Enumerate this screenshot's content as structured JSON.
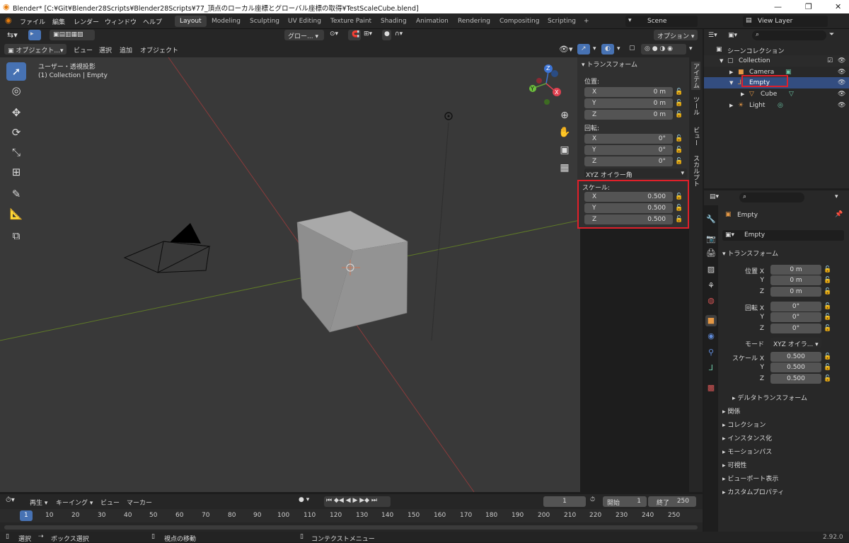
{
  "window": {
    "title": "Blender* [C:¥Git¥Blender28Scripts¥Blender28Scripts¥77_頂点のローカル座標とグローバル座標の取得¥TestScaleCube.blend]",
    "controls": [
      "—",
      "❐",
      "✕"
    ]
  },
  "menu": {
    "items": [
      "ファイル",
      "編集",
      "レンダー",
      "ウィンドウ",
      "ヘルプ"
    ],
    "workspaces": [
      "Layout",
      "Modeling",
      "Sculpting",
      "UV Editing",
      "Texture Paint",
      "Shading",
      "Animation",
      "Rendering",
      "Compositing",
      "Scripting"
    ],
    "add_tab": "+",
    "scene": "Scene",
    "view_layer": "View Layer"
  },
  "viewport_header": {
    "transform": "グロー...",
    "options": "オプション",
    "mode": "オブジェクト...",
    "menus": [
      "ビュー",
      "選択",
      "追加",
      "オブジェクト"
    ]
  },
  "viewport": {
    "info_line1": "ユーザー・透視投影",
    "info_line2": "(1) Collection | Empty",
    "gizmo": {
      "x": "X",
      "y": "Y",
      "z": "Z"
    }
  },
  "npanel": {
    "header": "トランスフォーム",
    "location_label": "位置:",
    "rotation_label": "回転:",
    "scale_label": "スケール:",
    "location": [
      {
        "axis": "X",
        "value": "0 m"
      },
      {
        "axis": "Y",
        "value": "0 m"
      },
      {
        "axis": "Z",
        "value": "0 m"
      }
    ],
    "rotation": [
      {
        "axis": "X",
        "value": "0°"
      },
      {
        "axis": "Y",
        "value": "0°"
      },
      {
        "axis": "Z",
        "value": "0°"
      }
    ],
    "rotation_mode": "XYZ オイラー角",
    "scale": [
      {
        "axis": "X",
        "value": "0.500"
      },
      {
        "axis": "Y",
        "value": "0.500"
      },
      {
        "axis": "Z",
        "value": "0.500"
      }
    ],
    "tabs": [
      "アイテム",
      "ツール",
      "ビュー",
      "スカルプト"
    ]
  },
  "outliner": {
    "root": "シーンコレクション",
    "collection": "Collection",
    "camera": "Camera",
    "empty": "Empty",
    "cube": "Cube",
    "light": "Light"
  },
  "properties": {
    "object_name": "Empty",
    "data_name": "Empty",
    "transform_header": "トランスフォーム",
    "location_x_label": "位置 X",
    "y_label": "Y",
    "z_label": "Z",
    "location": [
      "0 m",
      "0 m",
      "0 m"
    ],
    "rotation_x_label": "回転 X",
    "rotation": [
      "0°",
      "0°",
      "0°"
    ],
    "mode_label": "モード",
    "mode_value": "XYZ オイラ...",
    "scale_x_label": "スケール X",
    "scale": [
      "0.500",
      "0.500",
      "0.500"
    ],
    "delta": "デルタトランスフォーム",
    "sections": [
      "関係",
      "コレクション",
      "インスタンス化",
      "モーションパス",
      "可視性",
      "ビューポート表示",
      "カスタムプロパティ"
    ]
  },
  "timeline": {
    "menus": [
      "再生",
      "キーイング",
      "ビュー",
      "マーカー"
    ],
    "current_frame": "1",
    "start_label": "開始",
    "start": "1",
    "end_label": "終了",
    "end": "250",
    "ruler": [
      "1",
      "10",
      "20",
      "30",
      "40",
      "50",
      "60",
      "70",
      "80",
      "90",
      "100",
      "110",
      "120",
      "130",
      "140",
      "150",
      "160",
      "170",
      "180",
      "190",
      "200",
      "210",
      "220",
      "230",
      "240",
      "250"
    ]
  },
  "status": {
    "select": "選択",
    "box_select": "ボックス選択",
    "view_move": "視点の移動",
    "context_menu": "コンテクストメニュー",
    "version": "2.92.0"
  }
}
